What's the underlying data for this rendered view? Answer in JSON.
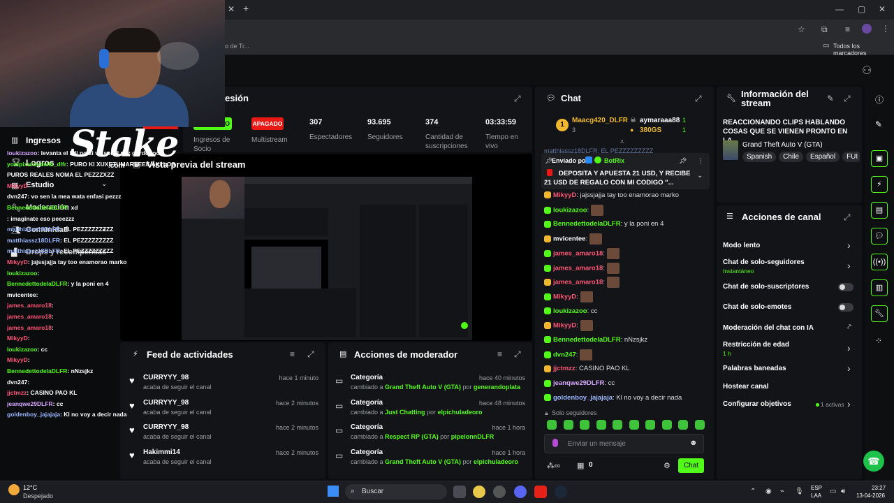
{
  "browser": {
    "new_tab": "+",
    "bookmarks_partial": "o de Tr...",
    "all_bookmarks": "Todos los marcadores"
  },
  "left_nav": {
    "items": [
      "Ingresos",
      "Logros",
      "Estudio",
      "Moderación",
      "Comunidad",
      "Drops y recompensas"
    ]
  },
  "overlay": {
    "logo_text": "Stake",
    "logo_sub": ".com"
  },
  "overlay_chat": [
    {
      "user": "loukizazoo",
      "text": ": levanta el kili po si vo soi el pez gordooooo",
      "color": "#d7a7ff"
    },
    {
      "user": "yoelpixulondelki_dlfr",
      "text": ": PURO KI XUXETUMAREEEE AKI LOS",
      "color": "#53fc18"
    },
    {
      "user": "",
      "text": "PUROS REALES NOMA EL PEZZZXZZ",
      "color": "#ffffff"
    },
    {
      "user": "MikyyD",
      "text": "",
      "color": "#ff5577"
    },
    {
      "user": "dvn247",
      "text": ": vo sen la mea wata enfasi pezzz",
      "color": "#ffffff"
    },
    {
      "user": "BennedettodelaDLFR",
      "text": ": xd",
      "color": "#53fc18"
    },
    {
      "user": "",
      "text": ": imaginate eso peeezzz",
      "color": "#ffffff"
    },
    {
      "user": "matthiassz18DLFR",
      "text": ": EL PEZZZZZZZZZ",
      "color": "#9ab6ff"
    },
    {
      "user": "matthiassz18DLFR",
      "text": ": EL PEZZZZZZZZZ",
      "color": "#9ab6ff"
    },
    {
      "user": "matthiassz18DLFR",
      "text": ": EL PEZZZZZZZZZ",
      "color": "#9ab6ff"
    },
    {
      "user": "MikyyD",
      "text": ": jajssjajja tay too enamorao marko",
      "color": "#ff5577"
    },
    {
      "user": "loukizazoo",
      "text": ":",
      "color": "#53fc18"
    },
    {
      "user": "BennedettodelaDLFR",
      "text": ": y la poni en 4",
      "color": "#53fc18"
    },
    {
      "user": "mvicentee",
      "text": ":",
      "color": "#ffffff"
    },
    {
      "user": "james_amaro18",
      "text": ":",
      "color": "#ff5577"
    },
    {
      "user": "james_amaro18",
      "text": ":",
      "color": "#ff5577"
    },
    {
      "user": "james_amaro18",
      "text": ":",
      "color": "#ff5577"
    },
    {
      "user": "MikyyD",
      "text": ":",
      "color": "#ff5577"
    },
    {
      "user": "loukizazoo",
      "text": ": cc",
      "color": "#53fc18"
    },
    {
      "user": "MikyyD",
      "text": ":",
      "color": "#ff5577"
    },
    {
      "user": "BennedettodelaDLFR",
      "text": ": nNzsjkz",
      "color": "#53fc18"
    },
    {
      "user": "dvn247",
      "text": ":",
      "color": "#ffffff"
    },
    {
      "user": "jjctmzz",
      "text": ": CASINO PAO KL",
      "color": "#ff5577"
    },
    {
      "user": "jeanqwe29DLFR",
      "text": ": cc",
      "color": "#d7a7ff"
    },
    {
      "user": "goldenboy_jajajaja",
      "text": ": Kl no voy a decir nada",
      "color": "#9ab6ff"
    }
  ],
  "session": {
    "title_partial": "esión",
    "stats": [
      {
        "value": "APAGADO",
        "label": "Multistream"
      },
      {
        "value": "307",
        "label": "Espectadores"
      },
      {
        "value": "93.695",
        "label": "Seguidores"
      },
      {
        "value": "374",
        "label": "Cantidad de suscripciones"
      },
      {
        "value": "03:33:59",
        "label": "Tiempo en vivo"
      }
    ],
    "income_label": "Ingresos de Socio",
    "income_value_partial": "O"
  },
  "preview": {
    "title": "Vista previa del stream"
  },
  "activity_feed": {
    "title": "Feed de actividades",
    "items": [
      {
        "name": "CURRYYY_98",
        "action": "acaba de seguir el canal",
        "time": "hace 1 minuto"
      },
      {
        "name": "CURRYYY_98",
        "action": "acaba de seguir el canal",
        "time": "hace 2 minutos"
      },
      {
        "name": "CURRYYY_98",
        "action": "acaba de seguir el canal",
        "time": "hace 2 minutos"
      },
      {
        "name": "Hakimmi14",
        "action": "acaba de seguir el canal",
        "time": "hace 2 minutos"
      }
    ]
  },
  "mod_actions": {
    "title": "Acciones de moderador",
    "items": [
      {
        "title": "Categoría",
        "prefix": "cambiado a ",
        "category": "Grand Theft Auto V (GTA)",
        "by": " por ",
        "mod": "generandoplata",
        "time": "hace 40 minutos"
      },
      {
        "title": "Categoría",
        "prefix": "cambiado a ",
        "category": "Just Chatting",
        "by": " por ",
        "mod": "elpichuladeoro",
        "time": "hace 48 minutos"
      },
      {
        "title": "Categoría",
        "prefix": "cambiado a ",
        "category": "Respect RP (GTA)",
        "by": " por ",
        "mod": "pipeionnDLFR",
        "time": "hace 1 hora"
      },
      {
        "title": "Categoría",
        "prefix": "cambiado a ",
        "category": "Grand Theft Auto V (GTA)",
        "by": " por ",
        "mod": "elpichuladeoro",
        "time": "hace 1 hora"
      }
    ]
  },
  "chat": {
    "title": "Chat",
    "leaderboard": [
      {
        "rank": "1",
        "name": "Maacg420_DLFR",
        "count": "3",
        "gifts": "1"
      },
      {
        "rank": "",
        "name": "aymaraaa88",
        "count": "380GS",
        "gifts": "1"
      }
    ],
    "pinned": {
      "sender_label": "Enviado por",
      "sender": "BotRix",
      "text": "DEPOSITA Y APUESTA 21 USD, Y RECIBE 21 USD DE REGALO CON MI CODIGO \"..."
    },
    "hidden_top": "matthiassz18DLFR: EL PEZZZZZZZZZ",
    "messages": [
      {
        "user": "MikyyD",
        "text": ": jajssjajja tay too enamorao marko",
        "color": "#ff5577"
      },
      {
        "user": "loukizazoo",
        "text": ":",
        "color": "#53fc18"
      },
      {
        "user": "BennedettodelaDLFR",
        "text": ": y la poni en 4",
        "color": "#53fc18"
      },
      {
        "user": "mvicentee",
        "text": ":",
        "color": "#ffffff"
      },
      {
        "user": "james_amaro18",
        "text": ":",
        "color": "#ff5577"
      },
      {
        "user": "james_amaro18",
        "text": ":",
        "color": "#ff5577"
      },
      {
        "user": "james_amaro18",
        "text": ":",
        "color": "#ff5577"
      },
      {
        "user": "MikyyD",
        "text": ":",
        "color": "#ff5577"
      },
      {
        "user": "loukizazoo",
        "text": ": cc",
        "color": "#53fc18"
      },
      {
        "user": "MikyyD",
        "text": ":",
        "color": "#ff5577"
      },
      {
        "user": "BennedettodelaDLFR",
        "text": ": nNzsjkz",
        "color": "#53fc18"
      },
      {
        "user": "dvn247",
        "text": ":",
        "color": "#53fc18"
      },
      {
        "user": "jjctmzz",
        "text": ": CASINO PAO KL",
        "color": "#ff5577"
      },
      {
        "user": "jeanqwe29DLFR",
        "text": ": cc",
        "color": "#d7a7ff"
      },
      {
        "user": "goldenboy_jajajaja",
        "text": ": Kl no voy a decir nada",
        "color": "#9ab6ff"
      }
    ],
    "followers_only": "Solo seguidores",
    "input_placeholder": "Enviar un mensaje",
    "send_label": "Chat",
    "points": "0"
  },
  "stream_info": {
    "title": "Información del stream",
    "stream_title": "REACCIONANDO CLIPS HABLANDO COSAS QUE SE VIENEN PRONTO EN LA...",
    "category": "Grand Theft Auto V (GTA)",
    "tags": [
      "Spanish",
      "Chile",
      "Español",
      "FUI"
    ]
  },
  "channel_actions": {
    "title": "Acciones de canal",
    "items": [
      {
        "label": "Modo lento",
        "sub": "",
        "control": "chevron"
      },
      {
        "label": "Chat de solo-seguidores",
        "sub": "Instantáneo",
        "control": "chevron"
      },
      {
        "label": "Chat de solo-suscriptores",
        "sub": "",
        "control": "toggle"
      },
      {
        "label": "Chat de solo-emotes",
        "sub": "",
        "control": "toggle"
      },
      {
        "label": "Moderación del chat con IA",
        "sub": "",
        "control": "external"
      },
      {
        "label": "Restricción de edad",
        "sub": "1 h",
        "control": "chevron"
      },
      {
        "label": "Palabras baneadas",
        "sub": "",
        "control": "chevron"
      },
      {
        "label": "Hostear canal",
        "sub": "",
        "control": "none"
      },
      {
        "label": "Configurar objetivos",
        "sub": "",
        "control": "chevron",
        "status": "1 activas"
      }
    ]
  },
  "taskbar": {
    "weather_temp": "12°C",
    "weather_desc": "Despejado",
    "search_placeholder": "Buscar",
    "lang": "ESP",
    "lang_sub": "LAA",
    "time": "23:27",
    "date": "13-04-2026"
  },
  "colors": {
    "accent": "#53fc18",
    "offline": "#e91916"
  }
}
